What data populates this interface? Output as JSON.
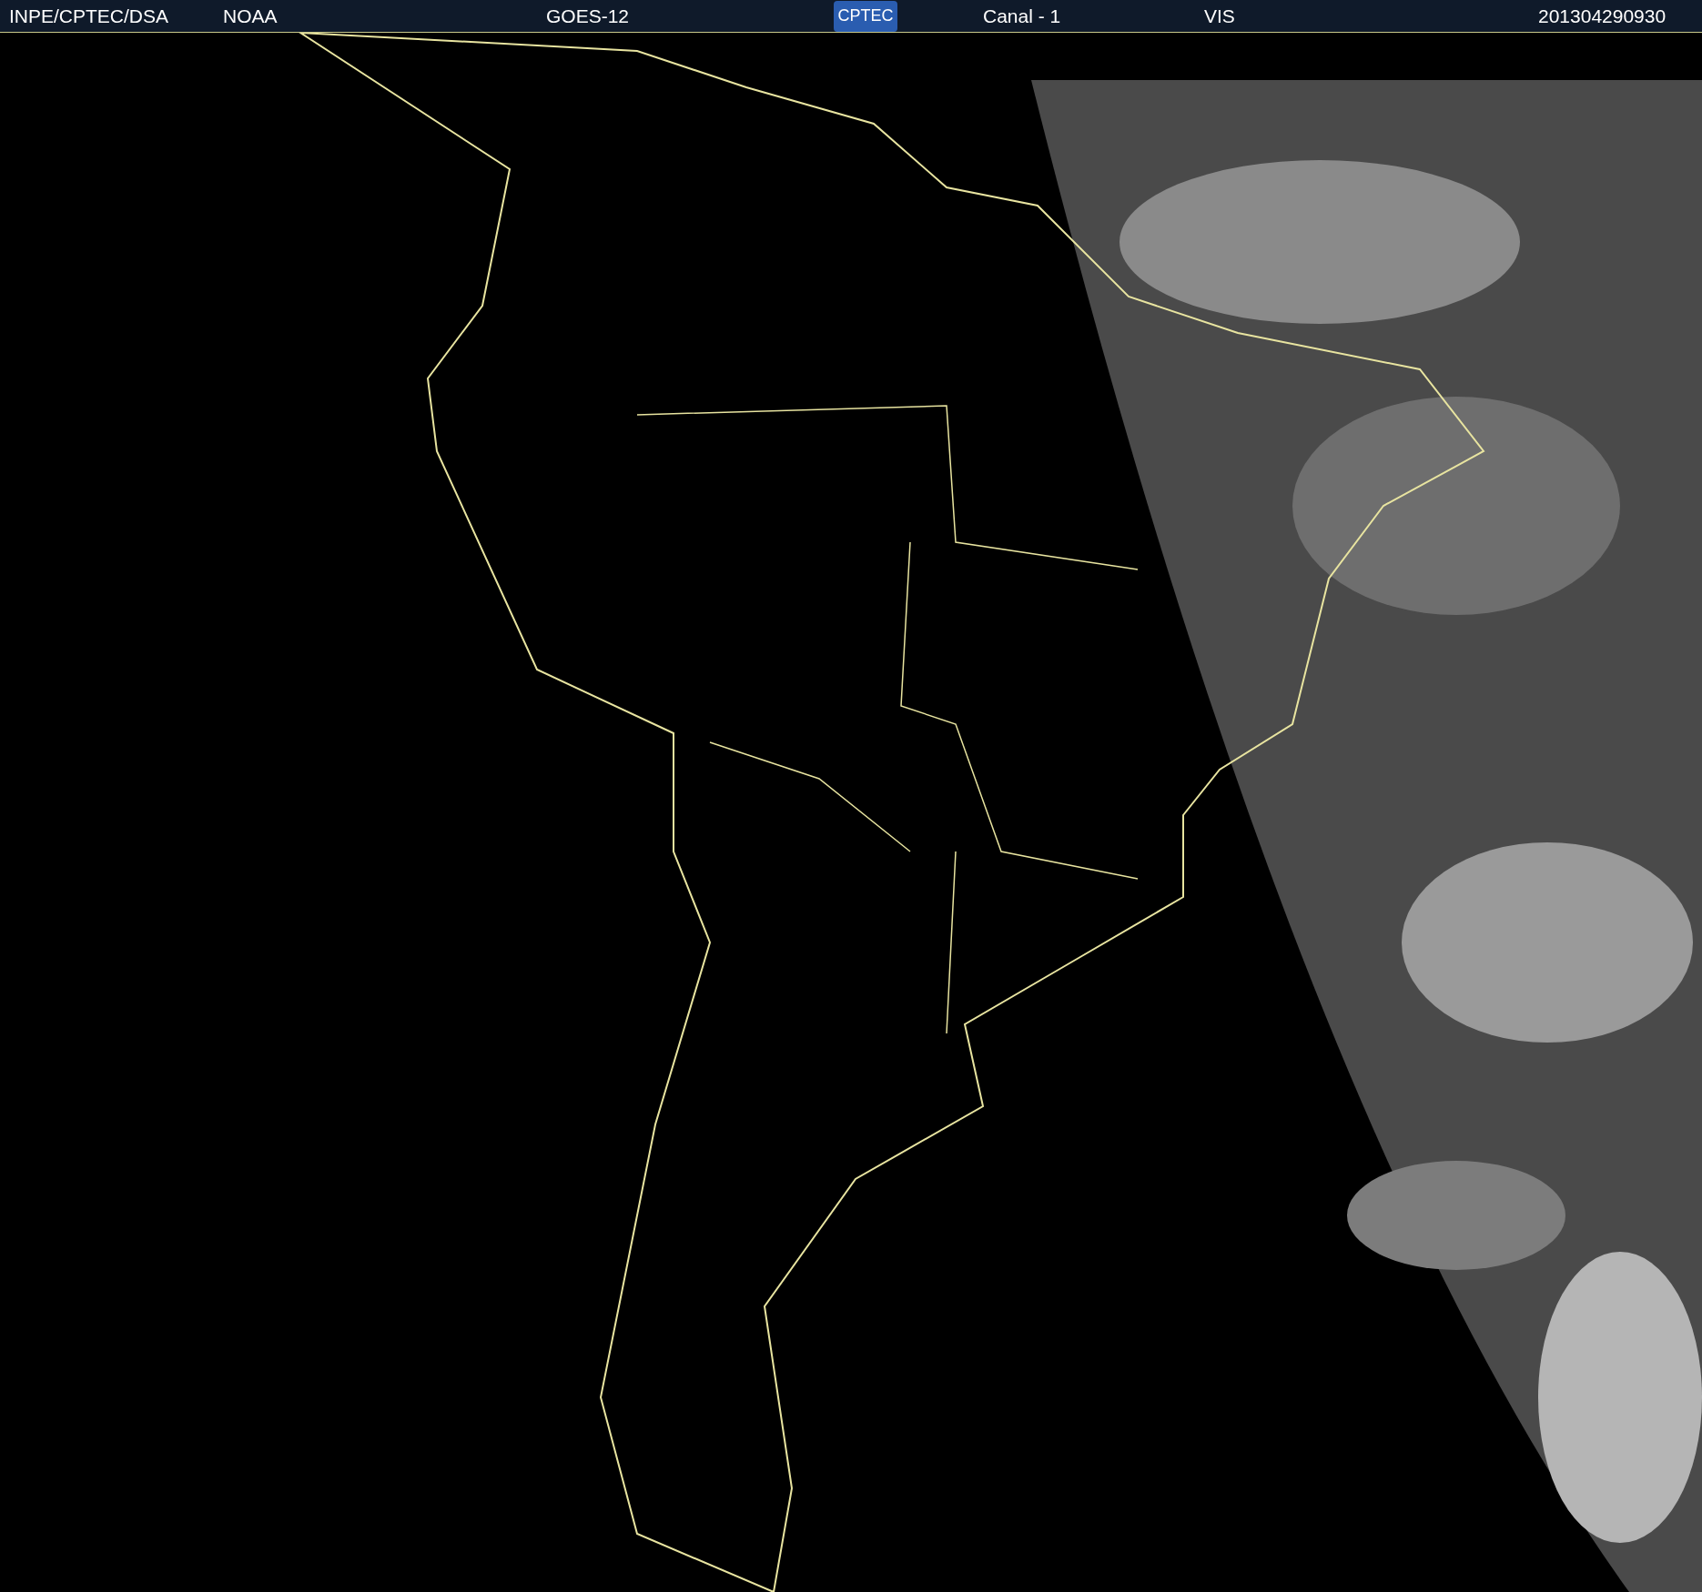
{
  "header": {
    "source": "INPE/CPTEC/DSA",
    "agency": "NOAA",
    "satellite": "GOES-12",
    "logo": "CPTEC",
    "channel": "Canal - 1",
    "band": "VIS",
    "timestamp": "201304290930"
  }
}
